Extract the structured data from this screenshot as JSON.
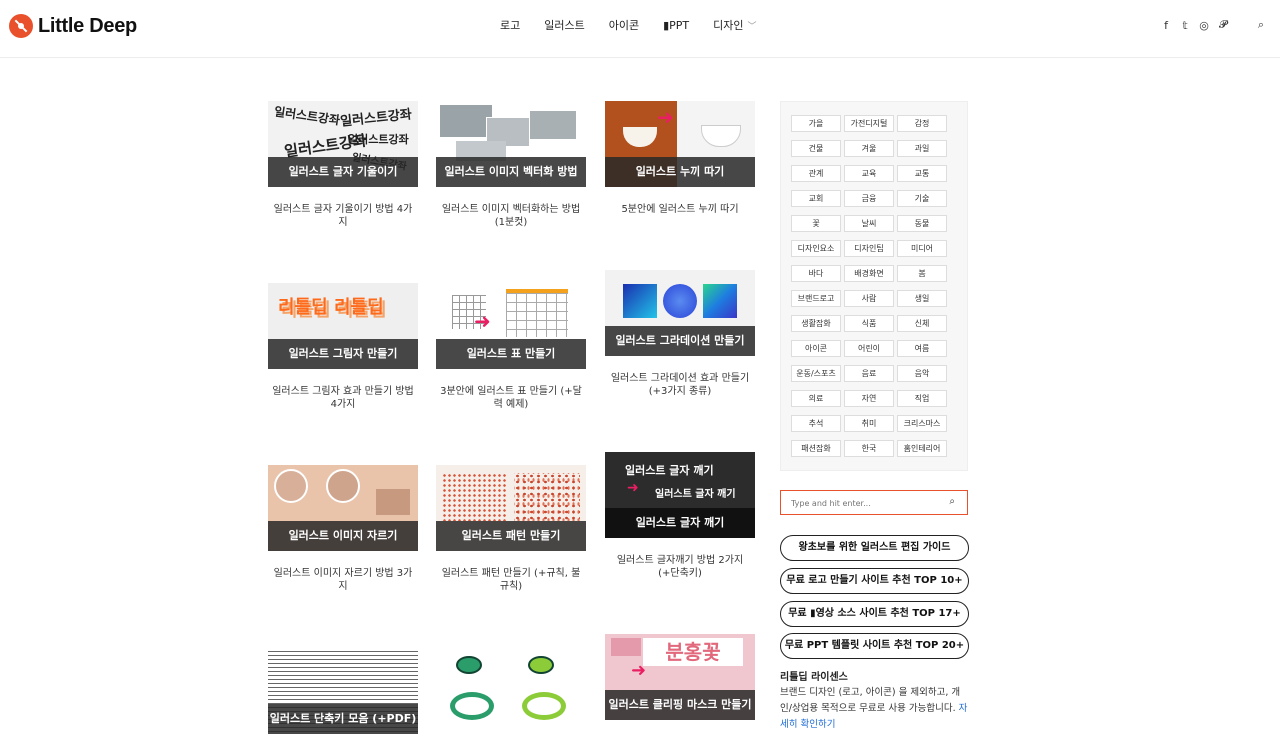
{
  "header": {
    "logo_text": "Little Deep",
    "nav": [
      "로고",
      "일러스트",
      "아이콘",
      "▮PPT",
      "디자인"
    ],
    "nav_dropdown_icon": "chevron-down-icon",
    "social": [
      "f",
      "𝕥",
      "◎",
      "𝓟"
    ],
    "search_icon": "⌕"
  },
  "posts": [
    {
      "cap": "일러스트 글자 기울이기",
      "title": "일러스트 글자 기울이기 방법 4가지"
    },
    {
      "cap": "일러스트 이미지 벡터화 방법",
      "title": "일러스트 이미지 벡터화하는 방법 (1분컷)"
    },
    {
      "cap": "일러스트 누끼 따기",
      "title": "5분안에 일러스트 누끼 따기"
    },
    {
      "cap": "일러스트 그림자 만들기",
      "title": "일러스트 그림자 효과 만들기 방법 4가지"
    },
    {
      "cap": "일러스트 표 만들기",
      "title": "3분안에 일러스트 표 만들기 (+달력 예제)"
    },
    {
      "cap": "일러스트 그라데이션 만들기",
      "title": "일러스트 그라데이션 효과 만들기 (+3가지 종류)"
    },
    {
      "cap": "일러스트 이미지 자르기",
      "title": "일러스트 이미지 자르기 방법 3가지"
    },
    {
      "cap": "일러스트 패턴 만들기",
      "title": "일러스트 패턴 만들기 (+규칙, 불규칙)"
    },
    {
      "cap": "일러스트 글자 깨기",
      "title": "일러스트 글자깨기 방법 2가지 (+단축키)"
    },
    {
      "cap": "일러스트 단축키 모음 (+PDF)",
      "title": ""
    },
    {
      "cap": "",
      "title": ""
    },
    {
      "cap": "일러스트 클리핑 마스크 만들기",
      "title": ""
    }
  ],
  "thumb_text": {
    "t1_a": "일러스트강좌",
    "t1_b": "일러스트강좌",
    "t1_c": "일러스트강좌",
    "t1_d": "일러스트강좌",
    "t1_e": "일러스트강좌",
    "t4": "리틀딥 리틀딥",
    "t9_a": "일러스트 글자 깨기",
    "t9_b": "일러스트 글자 깨기",
    "t12": "분홍꽃"
  },
  "tags": [
    "가을",
    "가전디지털",
    "감정",
    "건물",
    "겨울",
    "과일",
    "관계",
    "교육",
    "교통",
    "교회",
    "금융",
    "기술",
    "꽃",
    "날씨",
    "동물",
    "디자인요소",
    "디자인팁",
    "미디어",
    "바다",
    "배경화면",
    "봄",
    "브랜드로고",
    "사람",
    "생일",
    "생활잡화",
    "식품",
    "신체",
    "아이콘",
    "어린이",
    "여름",
    "운동/스포츠",
    "음료",
    "음악",
    "의료",
    "자연",
    "직업",
    "추석",
    "취미",
    "크리스마스",
    "패션잡화",
    "한국",
    "홈인테리어"
  ],
  "search": {
    "placeholder": "Type and hit enter..."
  },
  "pills": [
    "왕초보를 위한 일러스트 편집 가이드",
    "무료 로고 만들기 사이트 추천 TOP 10+",
    "무료 ▮영상 소스 사이트 추천 TOP 17+",
    "무료 PPT 템플릿 사이트 추천 TOP 20+"
  ],
  "license": {
    "title": "리틀딥 라이센스",
    "text": "브랜드 디자인 (로고, 아이콘) 을 제외하고, 개인/상업용 목적으로 무료로 사용 가능합니다. ",
    "link": "자세히 확인하기"
  },
  "colors": {
    "accent": "#e8512b",
    "link": "#1e6bd6",
    "caption_bg": "#282828"
  }
}
